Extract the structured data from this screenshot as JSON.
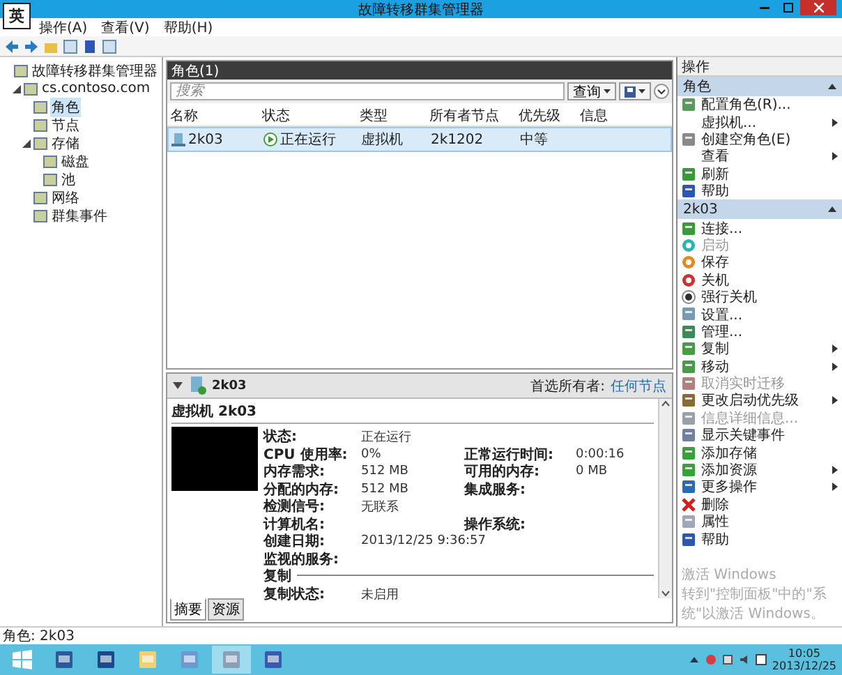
{
  "window": {
    "title": "故障转移群集管理器"
  },
  "ime_indicator": "英",
  "menu": [
    "操作(A)",
    "查看(V)",
    "帮助(H)"
  ],
  "tree": [
    {
      "label": "故障转移群集管理器",
      "selected": false,
      "children": [
        {
          "label": "cs.contoso.com",
          "selected": false,
          "expanded": true,
          "children": [
            {
              "label": "角色",
              "selected": true
            },
            {
              "label": "节点",
              "selected": false
            },
            {
              "label": "存储",
              "selected": false,
              "expanded": true,
              "children": [
                {
                  "label": "磁盘",
                  "selected": false
                },
                {
                  "label": "池",
                  "selected": false
                }
              ]
            },
            {
              "label": "网络",
              "selected": false
            },
            {
              "label": "群集事件",
              "selected": false
            }
          ]
        }
      ]
    }
  ],
  "roles": {
    "title": "角色(1)",
    "search": {
      "placeholder": "搜索"
    },
    "query_button": "查询",
    "columns": [
      "名称",
      "状态",
      "类型",
      "所有者节点",
      "优先级",
      "信息"
    ],
    "rows": [
      {
        "selected": true,
        "cells": [
          "2k03",
          "正在运行",
          "虚拟机",
          "2k1202",
          "中等"
        ]
      }
    ]
  },
  "detail": {
    "expanded": true,
    "name": "2k03",
    "preferred_owners_label": "首选所有者:",
    "preferred_owners_link": "任何节点",
    "heading": "虚拟机 2k03",
    "properties": [
      {
        "cells": [
          {
            "label": "状态:",
            "value": "正在运行"
          }
        ]
      },
      {
        "cells": [
          {
            "label": "CPU 使用率:",
            "value": "0%"
          },
          {
            "label": "正常运行时间:",
            "value": "0:00:16"
          }
        ]
      },
      {
        "cells": [
          {
            "label": "内存需求:",
            "value": "512 MB"
          },
          {
            "label": "可用的内存:",
            "value": "0 MB"
          }
        ]
      },
      {
        "cells": [
          {
            "label": "分配的内存:",
            "value": "512 MB"
          },
          {
            "label": "集成服务:"
          }
        ]
      },
      {
        "cells": [
          {
            "label": "检测信号:",
            "value": "无联系"
          }
        ]
      },
      {
        "cells": [
          {
            "label": "计算机名:"
          },
          {
            "label": "操作系统:"
          }
        ]
      },
      {
        "cells": [
          {
            "label": "创建日期:",
            "value": "2013/12/25 9:36:57"
          }
        ]
      },
      {
        "cells": [
          {
            "label": "监视的服务:"
          }
        ]
      }
    ],
    "replication": {
      "title": "复制",
      "properties": [
        {
          "label": "复制状态:",
          "value": "未启用"
        }
      ]
    },
    "tabs": [
      {
        "label": "摘要",
        "selected": true
      },
      {
        "label": "资源",
        "selected": false
      }
    ]
  },
  "activation_notice": {
    "title": "激活 Windows",
    "text": "转到\"控制面板\"中的\"系统\"以激活 Windows。"
  },
  "actions": {
    "title": "操作",
    "sections": [
      {
        "title": "角色",
        "expanded": true,
        "items": [
          {
            "label": "配置角色(R)...",
            "submenu": false,
            "disabled": false
          },
          {
            "label": "虚拟机...",
            "submenu": true,
            "disabled": false
          },
          {
            "label": "创建空角色(E)",
            "submenu": false,
            "disabled": false
          },
          {
            "label": "查看",
            "submenu": true,
            "disabled": false
          },
          {
            "label": "刷新",
            "submenu": false,
            "disabled": false
          },
          {
            "label": "帮助",
            "submenu": false,
            "disabled": false
          }
        ]
      },
      {
        "title": "2k03",
        "expanded": true,
        "items": [
          {
            "label": "连接...",
            "submenu": false,
            "disabled": false
          },
          {
            "label": "启动",
            "submenu": false,
            "disabled": true
          },
          {
            "label": "保存",
            "submenu": false,
            "disabled": false
          },
          {
            "label": "关机",
            "submenu": false,
            "disabled": false
          },
          {
            "label": "强行关机",
            "submenu": false,
            "disabled": false
          },
          {
            "label": "设置...",
            "submenu": false,
            "disabled": false
          },
          {
            "label": "管理...",
            "submenu": false,
            "disabled": false
          },
          {
            "label": "复制",
            "submenu": true,
            "disabled": false
          },
          {
            "label": "移动",
            "submenu": true,
            "disabled": false
          },
          {
            "label": "取消实时迁移",
            "submenu": false,
            "disabled": true
          },
          {
            "label": "更改启动优先级",
            "submenu": true,
            "disabled": false
          },
          {
            "label": "信息详细信息...",
            "submenu": false,
            "disabled": true
          },
          {
            "label": "显示关键事件",
            "submenu": false,
            "disabled": false
          },
          {
            "label": "添加存储",
            "submenu": false,
            "disabled": false
          },
          {
            "label": "添加资源",
            "submenu": true,
            "disabled": false
          },
          {
            "label": "更多操作",
            "submenu": true,
            "disabled": false
          },
          {
            "label": "删除",
            "submenu": false,
            "disabled": false
          },
          {
            "label": "属性",
            "submenu": false,
            "disabled": false
          },
          {
            "label": "帮助",
            "submenu": false,
            "disabled": false
          }
        ]
      }
    ]
  },
  "status_bar": "角色: 2k03",
  "taskbar": {
    "apps": [
      {
        "selected": false
      },
      {
        "selected": false
      },
      {
        "selected": false
      },
      {
        "selected": false
      },
      {
        "selected": true
      },
      {
        "selected": false
      }
    ],
    "clock_time": "10:05",
    "clock_date": "2013/12/25"
  }
}
